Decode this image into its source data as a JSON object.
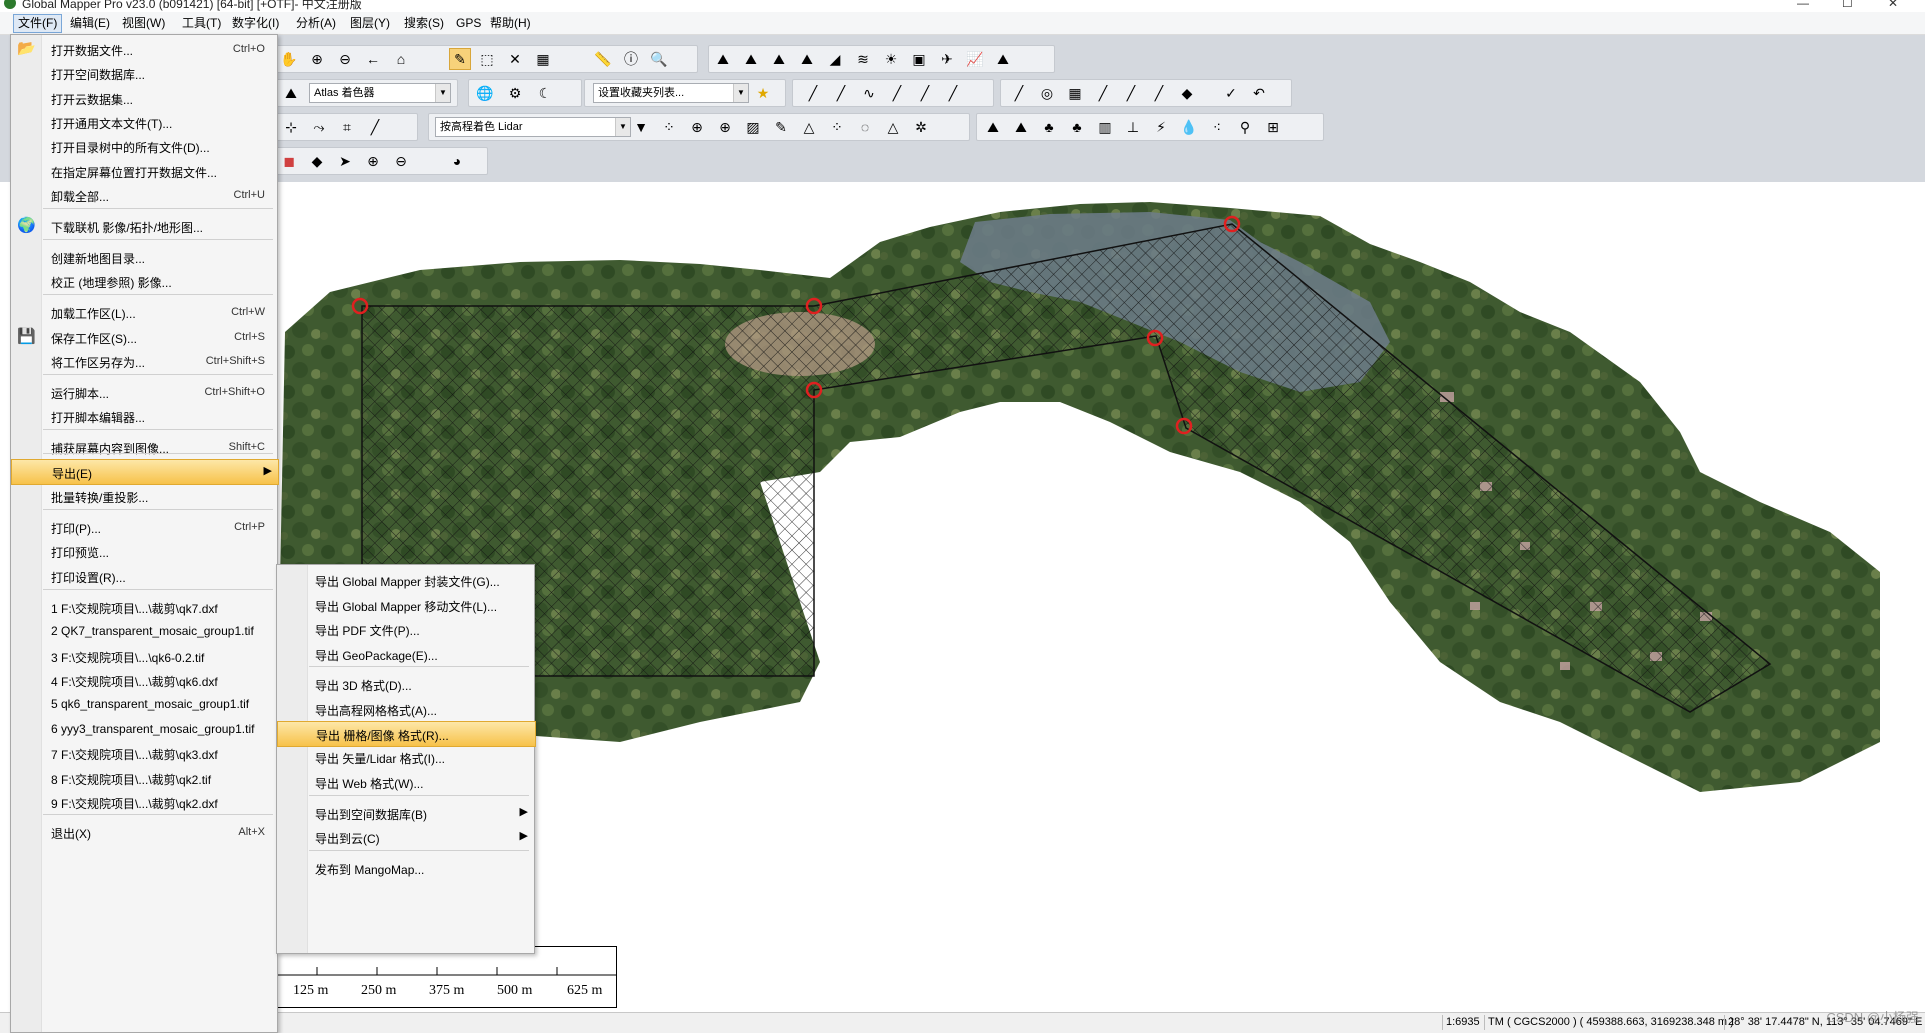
{
  "window": {
    "title": "Global Mapper Pro v23.0 (b091421) [64-bit] [+OTF]- 中文注册版",
    "controls": [
      "—",
      "☐",
      "✕"
    ]
  },
  "menubar": [
    "文件(F)",
    "编辑(E)",
    "视图(W)",
    "工具(T)",
    "数字化(I)",
    "分析(A)",
    "图层(Y)",
    "搜索(S)",
    "GPS",
    "帮助(H)"
  ],
  "toolbar": {
    "shader_combo": "Atlas 着色器",
    "favorites_combo": "设置收藏夹列表...",
    "lidar_combo": "按高程着色 Lidar"
  },
  "file_menu": {
    "items": [
      {
        "label": "打开数据文件...",
        "shortcut": "Ctrl+O",
        "icon": "folder-open-icon"
      },
      {
        "label": "打开空间数据库...",
        "shortcut": ""
      },
      {
        "label": "打开云数据集...",
        "shortcut": ""
      },
      {
        "label": "打开通用文本文件(T)...",
        "shortcut": ""
      },
      {
        "label": "打开目录树中的所有文件(D)...",
        "shortcut": ""
      },
      {
        "label": "在指定屏幕位置打开数据文件...",
        "shortcut": ""
      },
      {
        "label": "卸载全部...",
        "shortcut": "Ctrl+U"
      },
      {
        "label": "下载联机 影像/拓扑/地形图...",
        "shortcut": "",
        "icon": "globe-icon"
      },
      {
        "label": "创建新地图目录...",
        "shortcut": ""
      },
      {
        "label": "校正 (地理参照) 影像...",
        "shortcut": ""
      },
      {
        "label": "加载工作区(L)...",
        "shortcut": "Ctrl+W"
      },
      {
        "label": "保存工作区(S)...",
        "shortcut": "Ctrl+S",
        "icon": "save-icon"
      },
      {
        "label": "将工作区另存为...",
        "shortcut": "Ctrl+Shift+S"
      },
      {
        "label": "运行脚本...",
        "shortcut": "Ctrl+Shift+O"
      },
      {
        "label": "打开脚本编辑器...",
        "shortcut": ""
      },
      {
        "label": "捕获屏幕内容到图像...",
        "shortcut": "Shift+C"
      },
      {
        "label": "导出(E)",
        "shortcut": "",
        "submenu": true,
        "highlighted": true
      },
      {
        "label": "批量转换/重投影...",
        "shortcut": ""
      },
      {
        "label": "打印(P)...",
        "shortcut": "Ctrl+P"
      },
      {
        "label": "打印预览...",
        "shortcut": ""
      },
      {
        "label": "打印设置(R)...",
        "shortcut": ""
      },
      {
        "label": "1 F:\\交规院项目\\...\\裁剪\\qk7.dxf",
        "shortcut": ""
      },
      {
        "label": "2 QK7_transparent_mosaic_group1.tif",
        "shortcut": ""
      },
      {
        "label": "3 F:\\交规院项目\\...\\qk6-0.2.tif",
        "shortcut": ""
      },
      {
        "label": "4 F:\\交规院项目\\...\\裁剪\\qk6.dxf",
        "shortcut": ""
      },
      {
        "label": "5 qk6_transparent_mosaic_group1.tif",
        "shortcut": ""
      },
      {
        "label": "6 yyy3_transparent_mosaic_group1.tif",
        "shortcut": ""
      },
      {
        "label": "7 F:\\交规院项目\\...\\裁剪\\qk3.dxf",
        "shortcut": ""
      },
      {
        "label": "8 F:\\交规院项目\\...\\裁剪\\qk2.tif",
        "shortcut": ""
      },
      {
        "label": "9 F:\\交规院项目\\...\\裁剪\\qk2.dxf",
        "shortcut": ""
      },
      {
        "label": "退出(X)",
        "shortcut": "Alt+X"
      }
    ]
  },
  "export_submenu": {
    "items": [
      {
        "label": "导出 Global Mapper 封装文件(G)..."
      },
      {
        "label": "导出 Global Mapper 移动文件(L)..."
      },
      {
        "label": "导出 PDF 文件(P)..."
      },
      {
        "label": "导出 GeoPackage(E)..."
      },
      {
        "label": "导出 3D 格式(D)..."
      },
      {
        "label": "导出高程网格格式(A)..."
      },
      {
        "label": "导出 栅格/图像 格式(R)...",
        "highlighted": true
      },
      {
        "label": "导出 矢量/Lidar 格式(I)..."
      },
      {
        "label": "导出 Web 格式(W)..."
      },
      {
        "label": "导出到空间数据库(B)",
        "submenu": true
      },
      {
        "label": "导出到云(C)",
        "submenu": true
      },
      {
        "label": "发布到 MangoMap..."
      }
    ]
  },
  "scale_bar": {
    "labels": [
      "125 m",
      "250 m",
      "375 m",
      "500 m",
      "625 m"
    ]
  },
  "status_bar": {
    "scale": "1:6935",
    "projection": "TM ( CGCS2000 ) ( 459388.663, 3169238.348 m )",
    "coords": "28° 38' 17.4478\" N, 113° 35' 04.7469\" E",
    "watermark": "CSDN @小杨强"
  },
  "colors": {
    "menu_highlight": "#f7c24a",
    "polygon_vertex": "#e02020",
    "toolbar_bg": "#d4d8de"
  }
}
